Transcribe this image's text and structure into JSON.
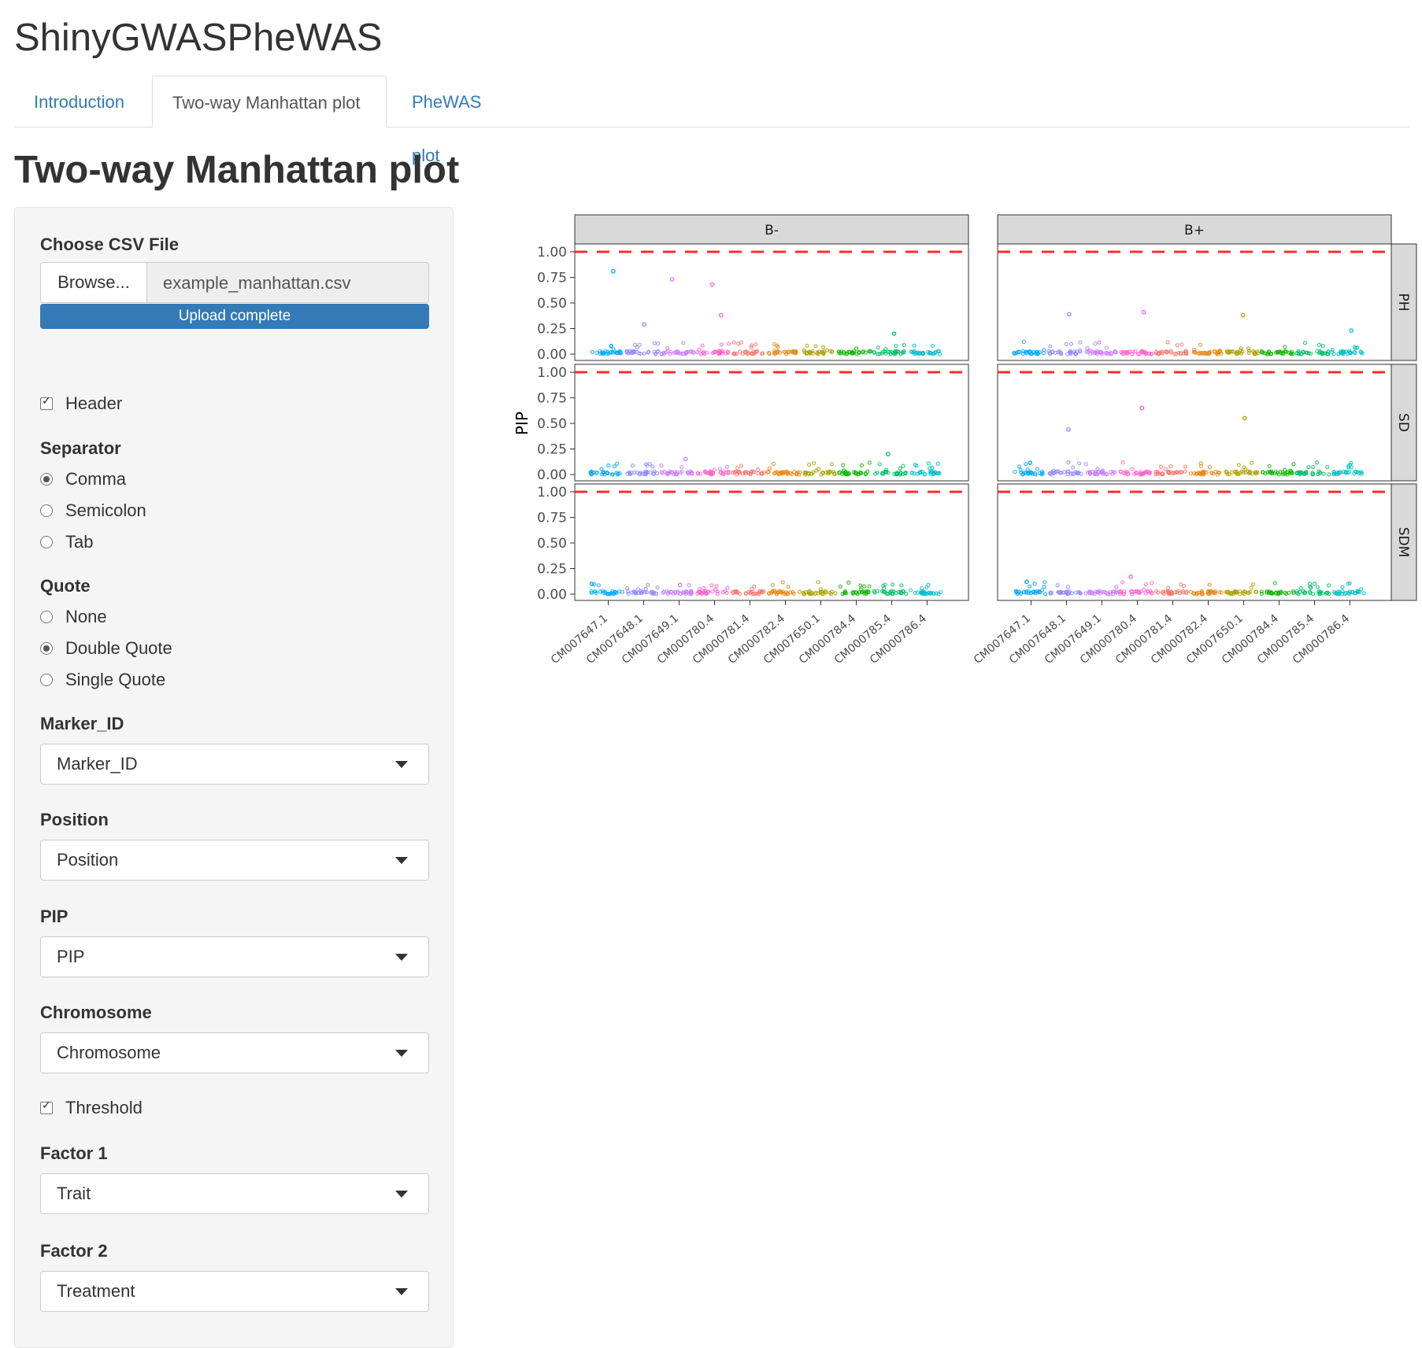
{
  "app": {
    "title": "ShinyGWASPheWAS"
  },
  "tabs": [
    {
      "label": "Introduction",
      "active": false
    },
    {
      "label": "Two-way Manhattan plot",
      "active": true
    },
    {
      "label": "PheWAS plot",
      "active": false
    }
  ],
  "page": {
    "title": "Two-way Manhattan plot"
  },
  "sidebar": {
    "file": {
      "label": "Choose CSV File",
      "browse_label": "Browse...",
      "filename": "example_manhattan.csv",
      "progress_label": "Upload complete",
      "progress": 1.0
    },
    "header": {
      "label": "Header",
      "checked": true
    },
    "separator": {
      "label": "Separator",
      "options": [
        "Comma",
        "Semicolon",
        "Tab"
      ],
      "selected": "Comma"
    },
    "quote": {
      "label": "Quote",
      "options": [
        "None",
        "Double Quote",
        "Single Quote"
      ],
      "selected": "Double Quote"
    },
    "marker_id": {
      "label": "Marker_ID",
      "value": "Marker_ID"
    },
    "position": {
      "label": "Position",
      "value": "Position"
    },
    "pip": {
      "label": "PIP",
      "value": "PIP"
    },
    "chromosome": {
      "label": "Chromosome",
      "value": "Chromosome"
    },
    "threshold": {
      "label": "Threshold",
      "checked": true
    },
    "factor1": {
      "label": "Factor 1",
      "value": "Trait"
    },
    "factor2": {
      "label": "Factor 2",
      "value": "Treatment"
    }
  },
  "chart_data": {
    "type": "scatter",
    "ylabel": "PIP",
    "ylim": [
      0,
      1
    ],
    "yticks": [
      "0.00",
      "0.25",
      "0.50",
      "0.75",
      "1.00"
    ],
    "threshold": 1.0,
    "threshold_color": "#ff2d2d",
    "columns": [
      "B-",
      "B+"
    ],
    "rows": [
      "PH",
      "SD",
      "SDM"
    ],
    "chromosomes": [
      "CM007647.1",
      "CM007648.1",
      "CM007649.1",
      "CM000780.4",
      "CM000781.4",
      "CM000782.4",
      "CM007650.1",
      "CM000784.4",
      "CM000785.4",
      "CM000786.4"
    ],
    "chromosome_colors": [
      "#00a9ff",
      "#8f8aff",
      "#c77cff",
      "#ff61cc",
      "#f8766d",
      "#e68613",
      "#aba300",
      "#0cb702",
      "#00be67",
      "#00bfc4"
    ],
    "peaks": [
      {
        "col": "B-",
        "row": "PH",
        "chromosome": "CM007647.1",
        "pip": 0.81
      },
      {
        "col": "B-",
        "row": "PH",
        "chromosome": "CM007648.1",
        "pip": 0.29
      },
      {
        "col": "B-",
        "row": "PH",
        "chromosome": "CM007649.1",
        "pip": 0.73
      },
      {
        "col": "B-",
        "row": "PH",
        "chromosome": "CM000780.4",
        "pip": 0.68
      },
      {
        "col": "B-",
        "row": "PH",
        "chromosome": "CM000780.4",
        "pip": 0.38
      },
      {
        "col": "B-",
        "row": "PH",
        "chromosome": "CM000785.4",
        "pip": 0.2
      },
      {
        "col": "B+",
        "row": "PH",
        "chromosome": "CM007648.1",
        "pip": 0.39
      },
      {
        "col": "B+",
        "row": "PH",
        "chromosome": "CM000780.4",
        "pip": 0.41
      },
      {
        "col": "B+",
        "row": "PH",
        "chromosome": "CM007650.1",
        "pip": 0.38
      },
      {
        "col": "B+",
        "row": "PH",
        "chromosome": "CM000786.4",
        "pip": 0.23
      },
      {
        "col": "B-",
        "row": "SD",
        "chromosome": "CM007649.1",
        "pip": 0.15
      },
      {
        "col": "B-",
        "row": "SD",
        "chromosome": "CM000785.4",
        "pip": 0.2
      },
      {
        "col": "B+",
        "row": "SD",
        "chromosome": "CM007648.1",
        "pip": 0.44
      },
      {
        "col": "B+",
        "row": "SD",
        "chromosome": "CM000780.4",
        "pip": 0.65
      },
      {
        "col": "B+",
        "row": "SD",
        "chromosome": "CM007650.1",
        "pip": 0.55
      },
      {
        "col": "B-",
        "row": "SDM",
        "chromosome": "CM007649.1",
        "pip": 0.09
      },
      {
        "col": "B+",
        "row": "SDM",
        "chromosome": "CM000780.4",
        "pip": 0.17
      },
      {
        "col": "B+",
        "row": "SDM",
        "chromosome": "CM007647.1",
        "pip": 0.12
      }
    ]
  }
}
